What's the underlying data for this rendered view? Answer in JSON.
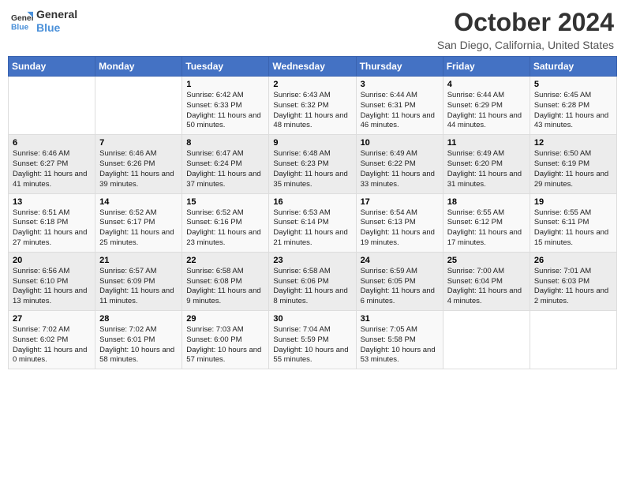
{
  "header": {
    "logo_line1": "General",
    "logo_line2": "Blue",
    "month_title": "October 2024",
    "location": "San Diego, California, United States"
  },
  "days_of_week": [
    "Sunday",
    "Monday",
    "Tuesday",
    "Wednesday",
    "Thursday",
    "Friday",
    "Saturday"
  ],
  "weeks": [
    [
      {
        "day": "",
        "detail": ""
      },
      {
        "day": "",
        "detail": ""
      },
      {
        "day": "1",
        "detail": "Sunrise: 6:42 AM\nSunset: 6:33 PM\nDaylight: 11 hours and 50 minutes."
      },
      {
        "day": "2",
        "detail": "Sunrise: 6:43 AM\nSunset: 6:32 PM\nDaylight: 11 hours and 48 minutes."
      },
      {
        "day": "3",
        "detail": "Sunrise: 6:44 AM\nSunset: 6:31 PM\nDaylight: 11 hours and 46 minutes."
      },
      {
        "day": "4",
        "detail": "Sunrise: 6:44 AM\nSunset: 6:29 PM\nDaylight: 11 hours and 44 minutes."
      },
      {
        "day": "5",
        "detail": "Sunrise: 6:45 AM\nSunset: 6:28 PM\nDaylight: 11 hours and 43 minutes."
      }
    ],
    [
      {
        "day": "6",
        "detail": "Sunrise: 6:46 AM\nSunset: 6:27 PM\nDaylight: 11 hours and 41 minutes."
      },
      {
        "day": "7",
        "detail": "Sunrise: 6:46 AM\nSunset: 6:26 PM\nDaylight: 11 hours and 39 minutes."
      },
      {
        "day": "8",
        "detail": "Sunrise: 6:47 AM\nSunset: 6:24 PM\nDaylight: 11 hours and 37 minutes."
      },
      {
        "day": "9",
        "detail": "Sunrise: 6:48 AM\nSunset: 6:23 PM\nDaylight: 11 hours and 35 minutes."
      },
      {
        "day": "10",
        "detail": "Sunrise: 6:49 AM\nSunset: 6:22 PM\nDaylight: 11 hours and 33 minutes."
      },
      {
        "day": "11",
        "detail": "Sunrise: 6:49 AM\nSunset: 6:20 PM\nDaylight: 11 hours and 31 minutes."
      },
      {
        "day": "12",
        "detail": "Sunrise: 6:50 AM\nSunset: 6:19 PM\nDaylight: 11 hours and 29 minutes."
      }
    ],
    [
      {
        "day": "13",
        "detail": "Sunrise: 6:51 AM\nSunset: 6:18 PM\nDaylight: 11 hours and 27 minutes."
      },
      {
        "day": "14",
        "detail": "Sunrise: 6:52 AM\nSunset: 6:17 PM\nDaylight: 11 hours and 25 minutes."
      },
      {
        "day": "15",
        "detail": "Sunrise: 6:52 AM\nSunset: 6:16 PM\nDaylight: 11 hours and 23 minutes."
      },
      {
        "day": "16",
        "detail": "Sunrise: 6:53 AM\nSunset: 6:14 PM\nDaylight: 11 hours and 21 minutes."
      },
      {
        "day": "17",
        "detail": "Sunrise: 6:54 AM\nSunset: 6:13 PM\nDaylight: 11 hours and 19 minutes."
      },
      {
        "day": "18",
        "detail": "Sunrise: 6:55 AM\nSunset: 6:12 PM\nDaylight: 11 hours and 17 minutes."
      },
      {
        "day": "19",
        "detail": "Sunrise: 6:55 AM\nSunset: 6:11 PM\nDaylight: 11 hours and 15 minutes."
      }
    ],
    [
      {
        "day": "20",
        "detail": "Sunrise: 6:56 AM\nSunset: 6:10 PM\nDaylight: 11 hours and 13 minutes."
      },
      {
        "day": "21",
        "detail": "Sunrise: 6:57 AM\nSunset: 6:09 PM\nDaylight: 11 hours and 11 minutes."
      },
      {
        "day": "22",
        "detail": "Sunrise: 6:58 AM\nSunset: 6:08 PM\nDaylight: 11 hours and 9 minutes."
      },
      {
        "day": "23",
        "detail": "Sunrise: 6:58 AM\nSunset: 6:06 PM\nDaylight: 11 hours and 8 minutes."
      },
      {
        "day": "24",
        "detail": "Sunrise: 6:59 AM\nSunset: 6:05 PM\nDaylight: 11 hours and 6 minutes."
      },
      {
        "day": "25",
        "detail": "Sunrise: 7:00 AM\nSunset: 6:04 PM\nDaylight: 11 hours and 4 minutes."
      },
      {
        "day": "26",
        "detail": "Sunrise: 7:01 AM\nSunset: 6:03 PM\nDaylight: 11 hours and 2 minutes."
      }
    ],
    [
      {
        "day": "27",
        "detail": "Sunrise: 7:02 AM\nSunset: 6:02 PM\nDaylight: 11 hours and 0 minutes."
      },
      {
        "day": "28",
        "detail": "Sunrise: 7:02 AM\nSunset: 6:01 PM\nDaylight: 10 hours and 58 minutes."
      },
      {
        "day": "29",
        "detail": "Sunrise: 7:03 AM\nSunset: 6:00 PM\nDaylight: 10 hours and 57 minutes."
      },
      {
        "day": "30",
        "detail": "Sunrise: 7:04 AM\nSunset: 5:59 PM\nDaylight: 10 hours and 55 minutes."
      },
      {
        "day": "31",
        "detail": "Sunrise: 7:05 AM\nSunset: 5:58 PM\nDaylight: 10 hours and 53 minutes."
      },
      {
        "day": "",
        "detail": ""
      },
      {
        "day": "",
        "detail": ""
      }
    ]
  ]
}
